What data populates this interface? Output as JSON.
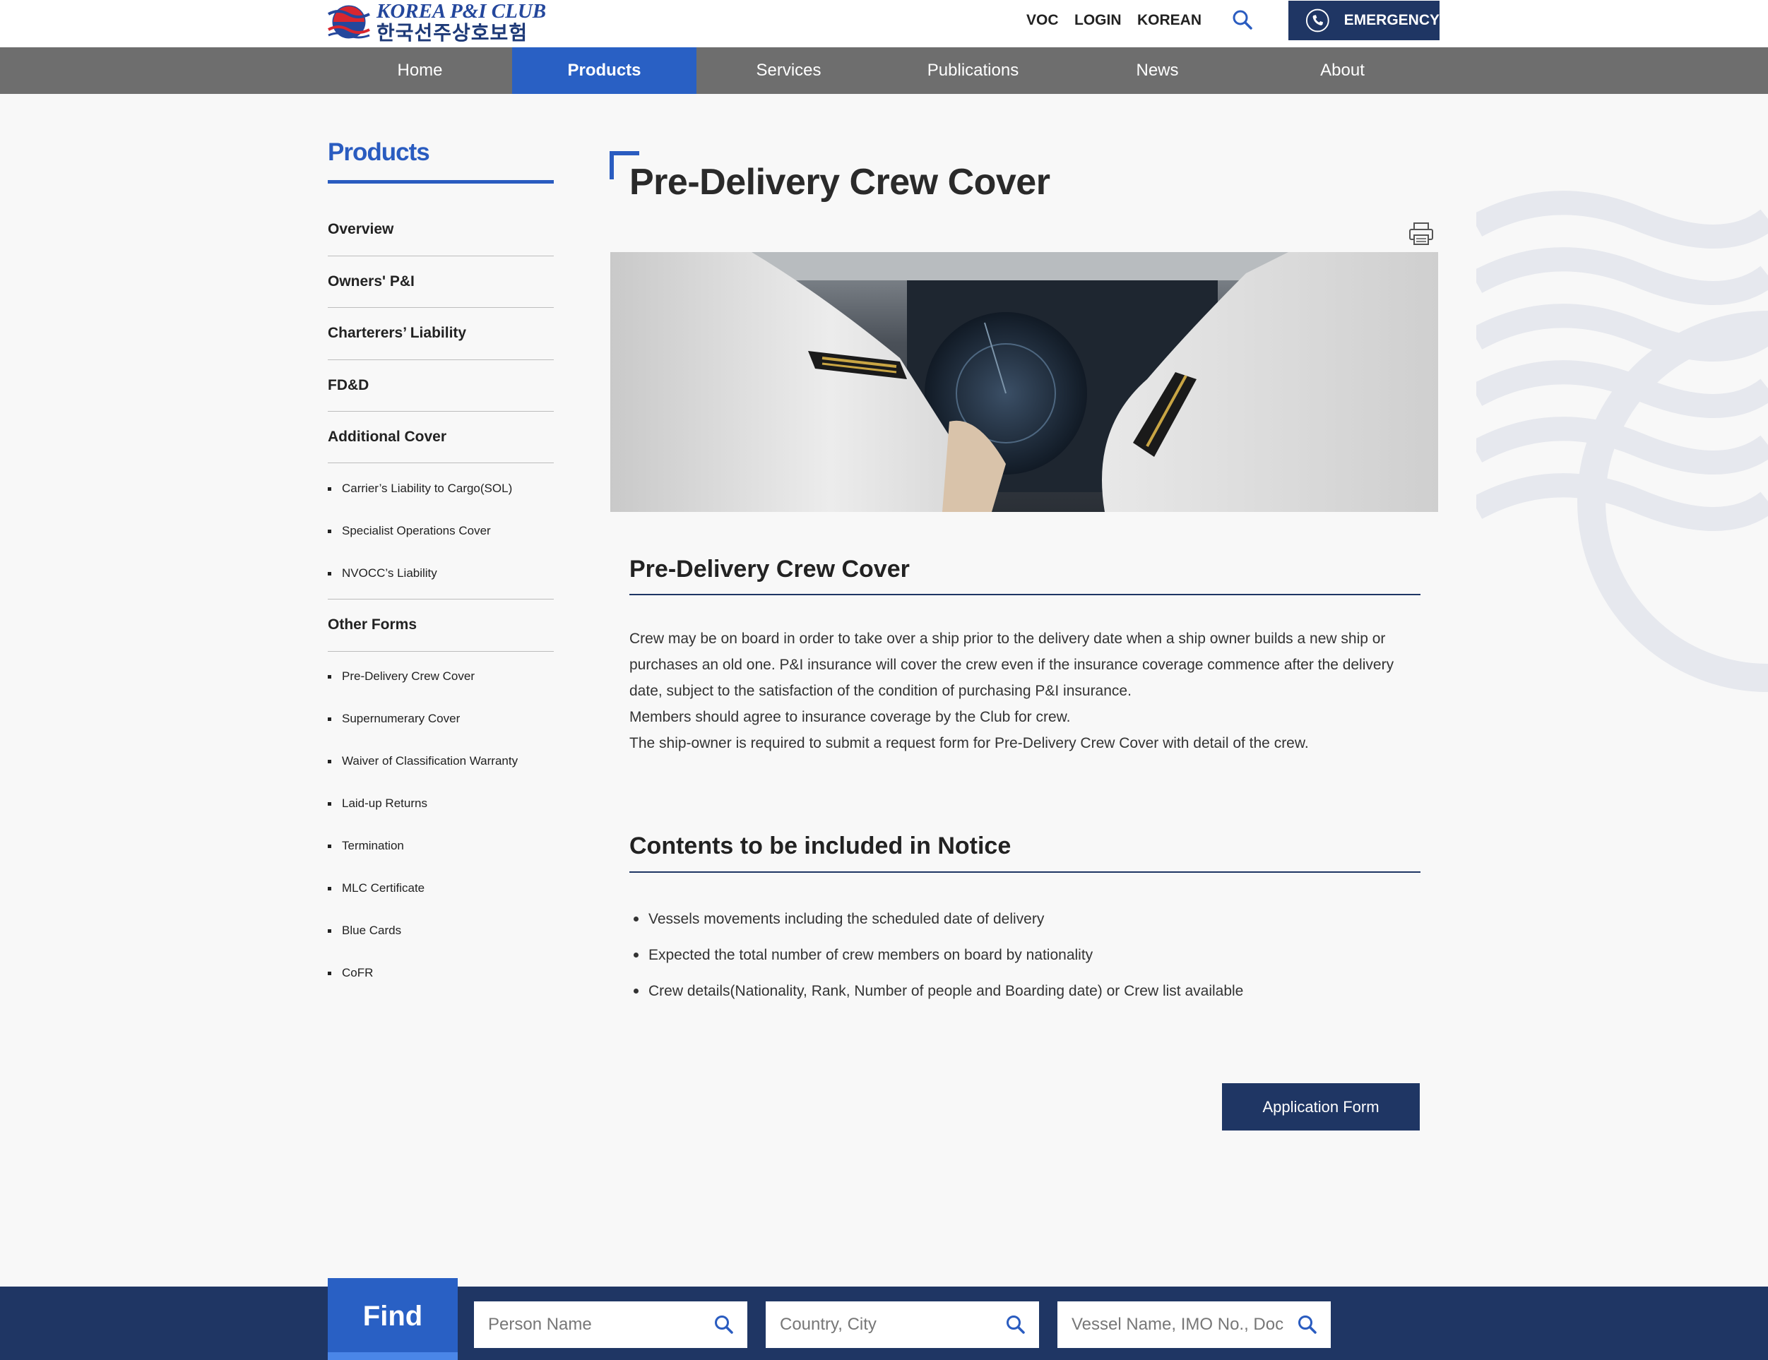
{
  "header": {
    "logo_en": "KOREA P&I CLUB",
    "logo_ko": "한국선주상호보험",
    "util_links": [
      "VOC",
      "LOGIN",
      "KOREAN"
    ],
    "emergency_label": "EMERGENCY",
    "search_icon": "search-icon"
  },
  "nav": {
    "items": [
      "Home",
      "Products",
      "Services",
      "Publications",
      "News",
      "About"
    ],
    "active": "Products"
  },
  "sidebar": {
    "title": "Products",
    "items": [
      "Overview",
      "Owners' P&I",
      "Charterers’ Liability",
      "FD&D",
      "Additional Cover"
    ],
    "additional_sub": [
      "Carrier’s Liability to Cargo(SOL)",
      "Specialist Operations Cover",
      "NVOCC’s Liability"
    ],
    "other_forms_label": "Other Forms",
    "other_sub": [
      "Pre-Delivery Crew Cover",
      "Supernumerary Cover",
      "Waiver of Classification Warranty",
      "Laid-up Returns",
      "Termination",
      "MLC Certificate",
      "Blue Cards",
      "CoFR"
    ]
  },
  "main": {
    "page_title": "Pre-Delivery Crew Cover",
    "section1_title": "Pre-Delivery Crew Cover",
    "paragraphs": [
      "Crew may be on board in order to take over a ship prior to the delivery date when a ship owner builds a new ship or purchases an old one. P&I insurance will cover the crew even if the insurance coverage commence after the delivery date, subject to the satisfaction of the condition of purchasing P&I insurance.",
      "Members should agree to insurance coverage by the Club for crew.",
      "The ship-owner is required to submit a request form for Pre-Delivery Crew Cover with detail of the crew."
    ],
    "section2_title": "Contents to be included in Notice",
    "bullets": [
      "Vessels movements including the scheduled date of delivery",
      "Expected the total number of crew members on board by nationality",
      "Crew details(Nationality, Rank, Number of people and Boarding date) or Crew list available"
    ],
    "application_button": "Application Form"
  },
  "find": {
    "label": "Find",
    "placeholders": [
      "Person Name",
      "Country, City",
      "Vessel Name, IMO No., Doc No"
    ]
  },
  "colors": {
    "navy": "#1f3664",
    "brand_blue": "#2960c4",
    "nav_gray": "#6e6e6e"
  }
}
